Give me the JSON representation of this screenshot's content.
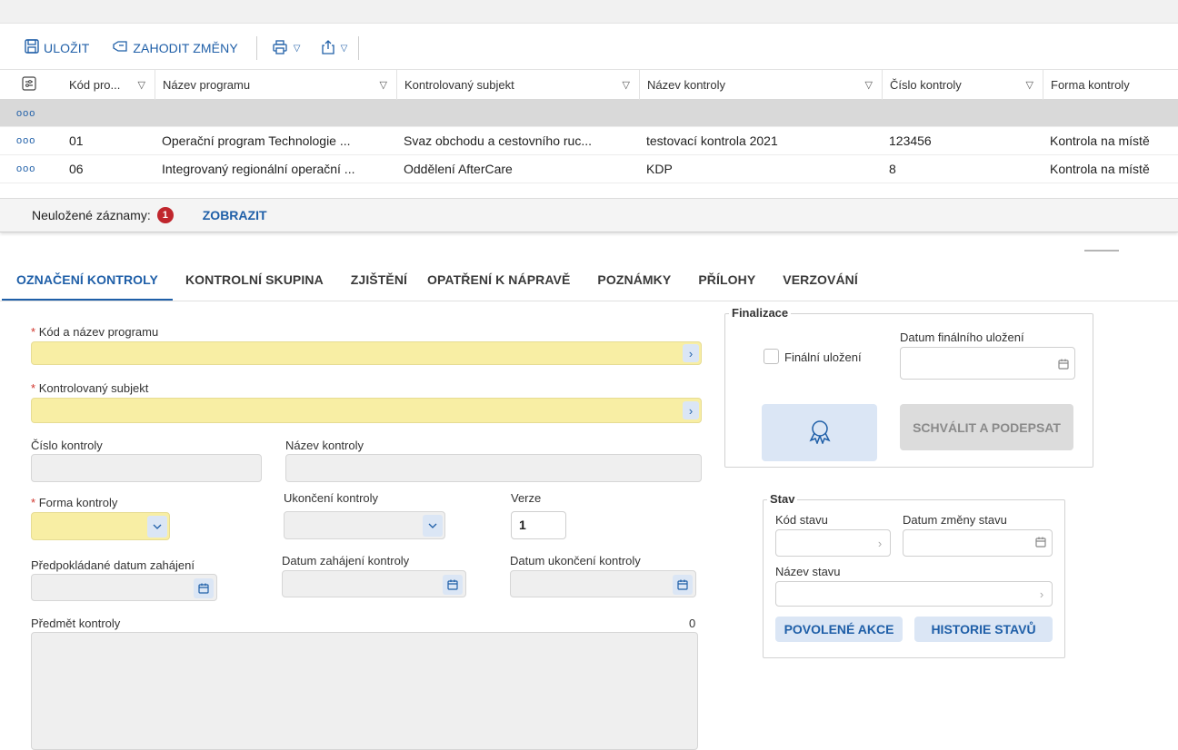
{
  "toolbar": {
    "save_label": "ULOŽIT",
    "discard_label": "ZAHODIT ZMĚNY",
    "print_icon": "print-icon",
    "export_icon": "share-icon"
  },
  "grid": {
    "headers": [
      "Kód pro...",
      "Název programu",
      "Kontrolovaný subjekt",
      "Název kontroly",
      "Číslo kontroly",
      "Forma kontroly"
    ],
    "rows": [
      {
        "code": "",
        "program": "",
        "subject": "",
        "name": "",
        "number": "",
        "form": ""
      },
      {
        "code": "01",
        "program": "Operační program Technologie ...",
        "subject": "Svaz obchodu a cestovního ruc...",
        "name": "testovací kontrola 2021",
        "number": "123456",
        "form": "Kontrola na místě"
      },
      {
        "code": "06",
        "program": "Integrovaný regionální operační ...",
        "subject": "Oddělení AfterCare",
        "name": "KDP",
        "number": "8",
        "form": "Kontrola na místě"
      }
    ],
    "row_dots": "ooo"
  },
  "unsaved": {
    "label": "Neuložené záznamy:",
    "count": "1",
    "show_label": "ZOBRAZIT"
  },
  "tabs": [
    "OZNAČENÍ KONTROLY",
    "KONTROLNÍ SKUPINA",
    "ZJIŠTĚNÍ",
    "OPATŘENÍ K NÁPRAVĚ",
    "POZNÁMKY",
    "PŘÍLOHY",
    "VERZOVÁNÍ"
  ],
  "form": {
    "required_mark": "*",
    "program_label": "Kód a název programu",
    "subject_label": "Kontrolovaný subjekt",
    "number_label": "Číslo kontroly",
    "name_label": "Název kontroly",
    "form_label": "Forma kontroly",
    "end_label": "Ukončení kontroly",
    "version_label": "Verze",
    "version_value": "1",
    "planned_start_label": "Předpokládané datum zahájení",
    "start_label": "Datum zahájení kontroly",
    "finish_label": "Datum ukončení kontroly",
    "subject_matter_label": "Předmět kontroly",
    "subject_matter_count": "0"
  },
  "finalization": {
    "legend": "Finalizace",
    "final_save_label": "Finální uložení",
    "final_date_label": "Datum finálního uložení",
    "approve_label": "SCHVÁLIT A PODEPSAT"
  },
  "status": {
    "legend": "Stav",
    "code_label": "Kód stavu",
    "change_date_label": "Datum změny stavu",
    "name_label": "Název stavu",
    "allowed_actions_label": "POVOLENÉ AKCE",
    "history_label": "HISTORIE STAVŮ"
  }
}
